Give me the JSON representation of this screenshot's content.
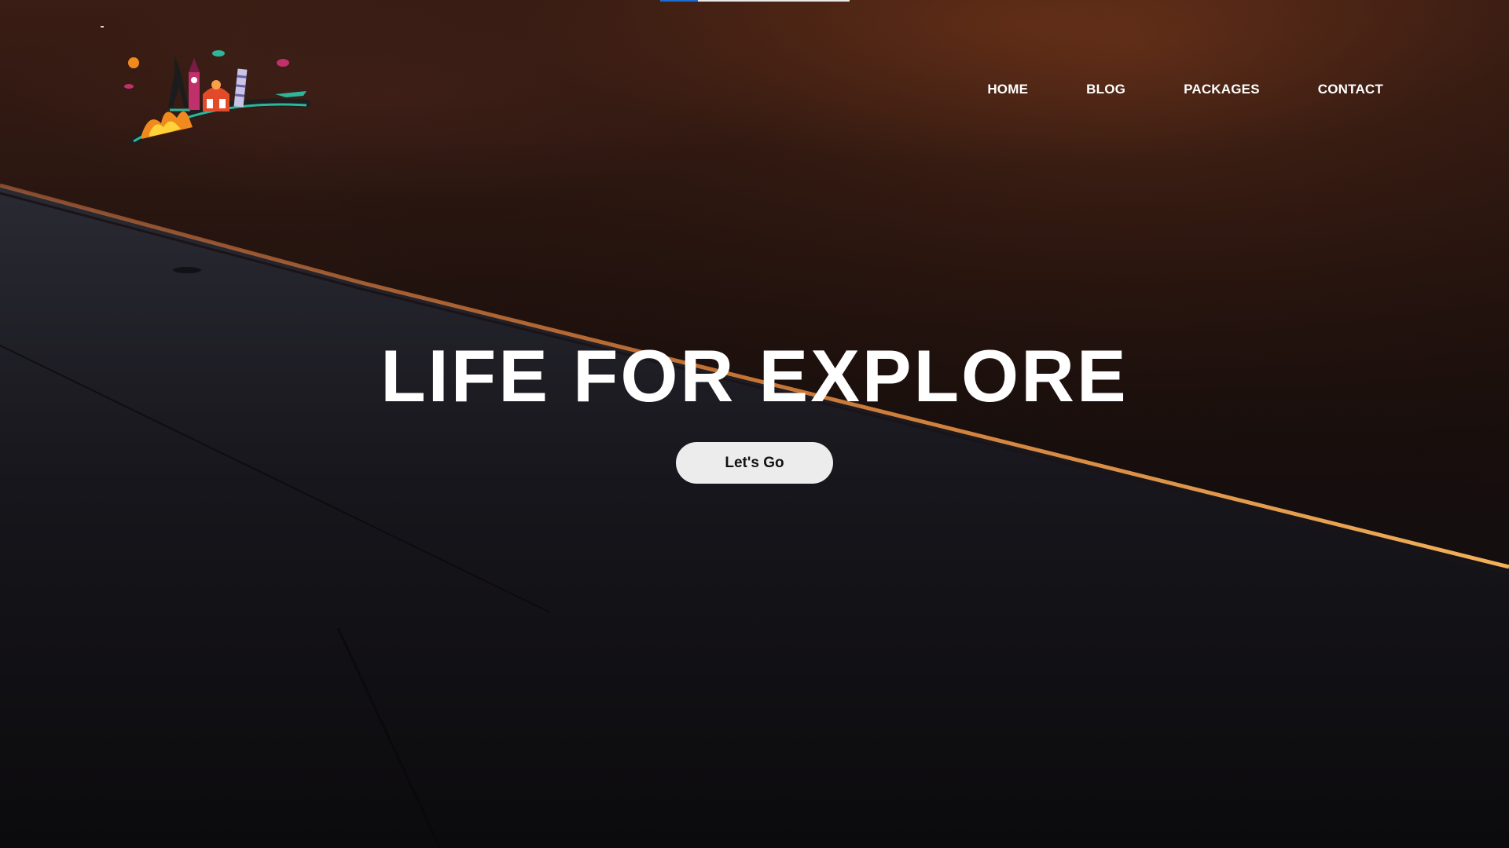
{
  "page": {
    "title": "LIFE FOR EXPLORE"
  },
  "scroll_indicator": {
    "progress": 0.2
  },
  "header": {
    "logo_icon": "travel-landmarks-logo-icon",
    "nav": [
      {
        "label": "HOME"
      },
      {
        "label": "BLOG"
      },
      {
        "label": "PACKAGES"
      },
      {
        "label": "CONTACT"
      }
    ]
  },
  "hero": {
    "headline": "LIFE FOR EXPLORE",
    "cta_label": "Let's Go"
  },
  "colors": {
    "accent": "#1c6fd1",
    "nav_text": "#ffffff",
    "button_bg": "#ececec",
    "button_text": "#111111",
    "sky_dark": "#2c1711",
    "wing_glow": "#f5a04a"
  }
}
